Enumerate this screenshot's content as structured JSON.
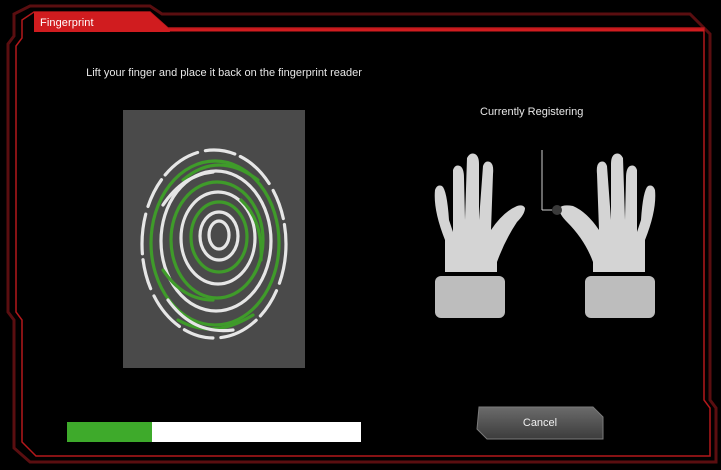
{
  "dialog": {
    "title": "Fingerprint",
    "instruction": "Lift your finger and place it back on the fingerprint reader",
    "accent_color": "#d01c1f"
  },
  "scan": {
    "icon": "fingerprint-icon",
    "scanned_color": "#3f9b2a",
    "unscanned_color": "#e6e6e6"
  },
  "hands": {
    "icon": "hands-icon",
    "current_label": "Currently Registering",
    "current_finger": "right-index"
  },
  "progress": {
    "value": 0.29,
    "color": "#3eaa2b"
  },
  "actions": {
    "cancel_label": "Cancel"
  }
}
